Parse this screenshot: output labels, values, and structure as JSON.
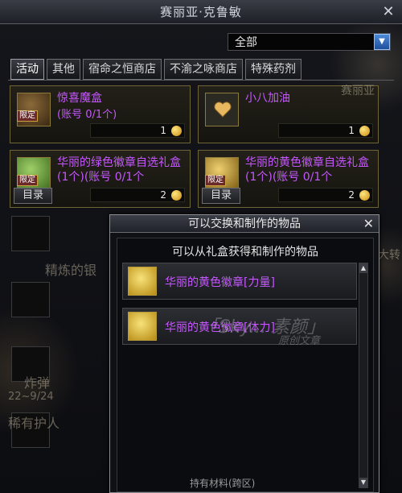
{
  "window": {
    "title": "赛丽亚·克鲁敏",
    "close": "✕"
  },
  "filter": {
    "value": "全部",
    "arrow": "▼"
  },
  "tabs": [
    {
      "label": "活动",
      "active": true
    },
    {
      "label": "其他"
    },
    {
      "label": "宿命之恒商店"
    },
    {
      "label": "不渝之咏商店"
    },
    {
      "label": "特殊药剂"
    }
  ],
  "items": [
    {
      "name": "惊喜魔盒",
      "sub": "(账号 0/1个)",
      "price": "1",
      "limited": "限定",
      "icon": "surprise-box-icon"
    },
    {
      "name": "小八加油",
      "sub": "",
      "price": "1",
      "icon": "heart-card-icon"
    },
    {
      "name": "华丽的绿色徽章自选礼盒 (1个)(账号 0/1个",
      "price": "2",
      "limited": "限定",
      "catalog": "目录",
      "icon": "green-gift-box-icon"
    },
    {
      "name": "华丽的黄色徽章自选礼盒 (1个)(账号 0/1个",
      "price": "2",
      "limited": "限定",
      "catalog": "目录",
      "icon": "gold-gift-box-icon"
    }
  ],
  "background_text": {
    "left1": "精炼的银",
    "left2": "炸弹",
    "left3": "22~9/24",
    "left4": "稀有护人",
    "right1": "赛丽亚",
    "right2": "大转"
  },
  "popup": {
    "title": "可以交换和制作的物品",
    "close": "✕",
    "subtitle": "可以从礼盒获得和制作的物品",
    "rows": [
      {
        "label": "华丽的黄色徽章[力量]",
        "icon": "strength-emblem-icon"
      },
      {
        "label": "华丽的黄色徽章[体力]",
        "icon": "vitality-emblem-icon"
      }
    ],
    "watermark": "「Sky... 素颜」",
    "watermark2": "原创文章",
    "footer": "持有材料(跨区)"
  },
  "colors": {
    "purple_name": "#c657ff",
    "gold": "#f0d070",
    "accent_blue": "#3f7fd0"
  }
}
